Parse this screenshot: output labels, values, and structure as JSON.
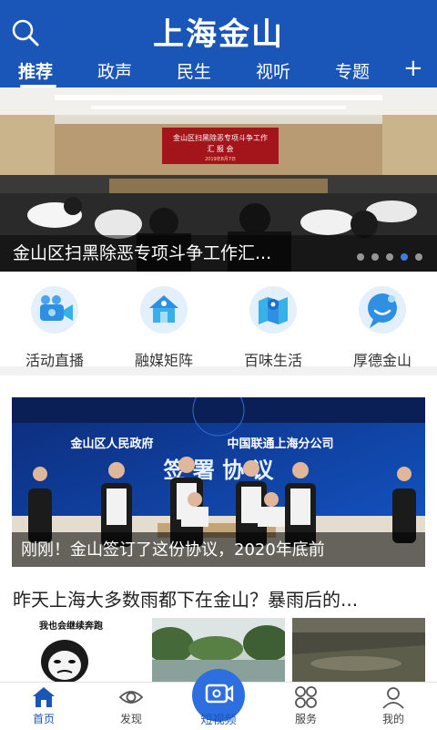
{
  "header": {
    "title": "上海金山",
    "tabs": [
      "推荐",
      "政声",
      "民生",
      "视听",
      "专题"
    ],
    "add_label": "+"
  },
  "hero": {
    "caption": "金山区扫黑除恶专项斗争工作汇...",
    "banner_text_line1": "金山区扫黑除恶专项斗争工作",
    "banner_text_line2": "汇 报 会",
    "banner_date": "2019年8月7日",
    "slide_count": 5,
    "active_slide": 4
  },
  "features": [
    {
      "label": "活动直播",
      "icon": "video-camera-icon"
    },
    {
      "label": "融媒矩阵",
      "icon": "matrix-house-icon"
    },
    {
      "label": "百味生活",
      "icon": "map-life-icon"
    },
    {
      "label": "厚德金山",
      "icon": "smile-chat-icon"
    }
  ],
  "card1": {
    "caption": "刚刚！金山签订了这份协议，2020年底前",
    "banner_org1": "金山区人民政府",
    "banner_org2": "中国联通上海分公司",
    "banner_title": "签 署 协 议"
  },
  "article": {
    "title": "昨天上海大多数雨都下在金山？暴雨后的...",
    "thumb1_caption": "我也会继续奔跑"
  },
  "bottom_nav": {
    "home": "首页",
    "discover": "发现",
    "short_video": "短视频",
    "service": "服务",
    "mine": "我的"
  },
  "colors": {
    "brand_blue": "#1a56b8",
    "accent_blue": "#2d6fe0"
  }
}
